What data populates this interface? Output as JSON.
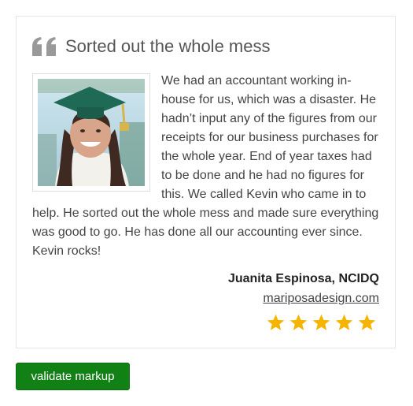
{
  "testimonial": {
    "title": "Sorted out the whole mess",
    "body": "We had an accountant working in-house for us, which was a disaster. He hadn’t input any of the figures from our receipts for our business purchases for the whole year. End of year taxes had to be done and he had no figures for this. We called Kevin who came in to help. He sorted out the whole mess and made sure everything was good to go. He has done all our accounting ever since. Kevin rocks!",
    "author": "Juanita Espinosa, NCIDQ",
    "website": "mariposadesign.com",
    "rating": 5,
    "rating_max": 5,
    "colors": {
      "quote_icon": "#999999",
      "star": "#f5b400"
    },
    "icons": {
      "quote": "quote-icon",
      "star": "star-icon",
      "photo": "person-photo"
    }
  },
  "validate_button": {
    "label": "validate markup",
    "color": "#118015"
  }
}
